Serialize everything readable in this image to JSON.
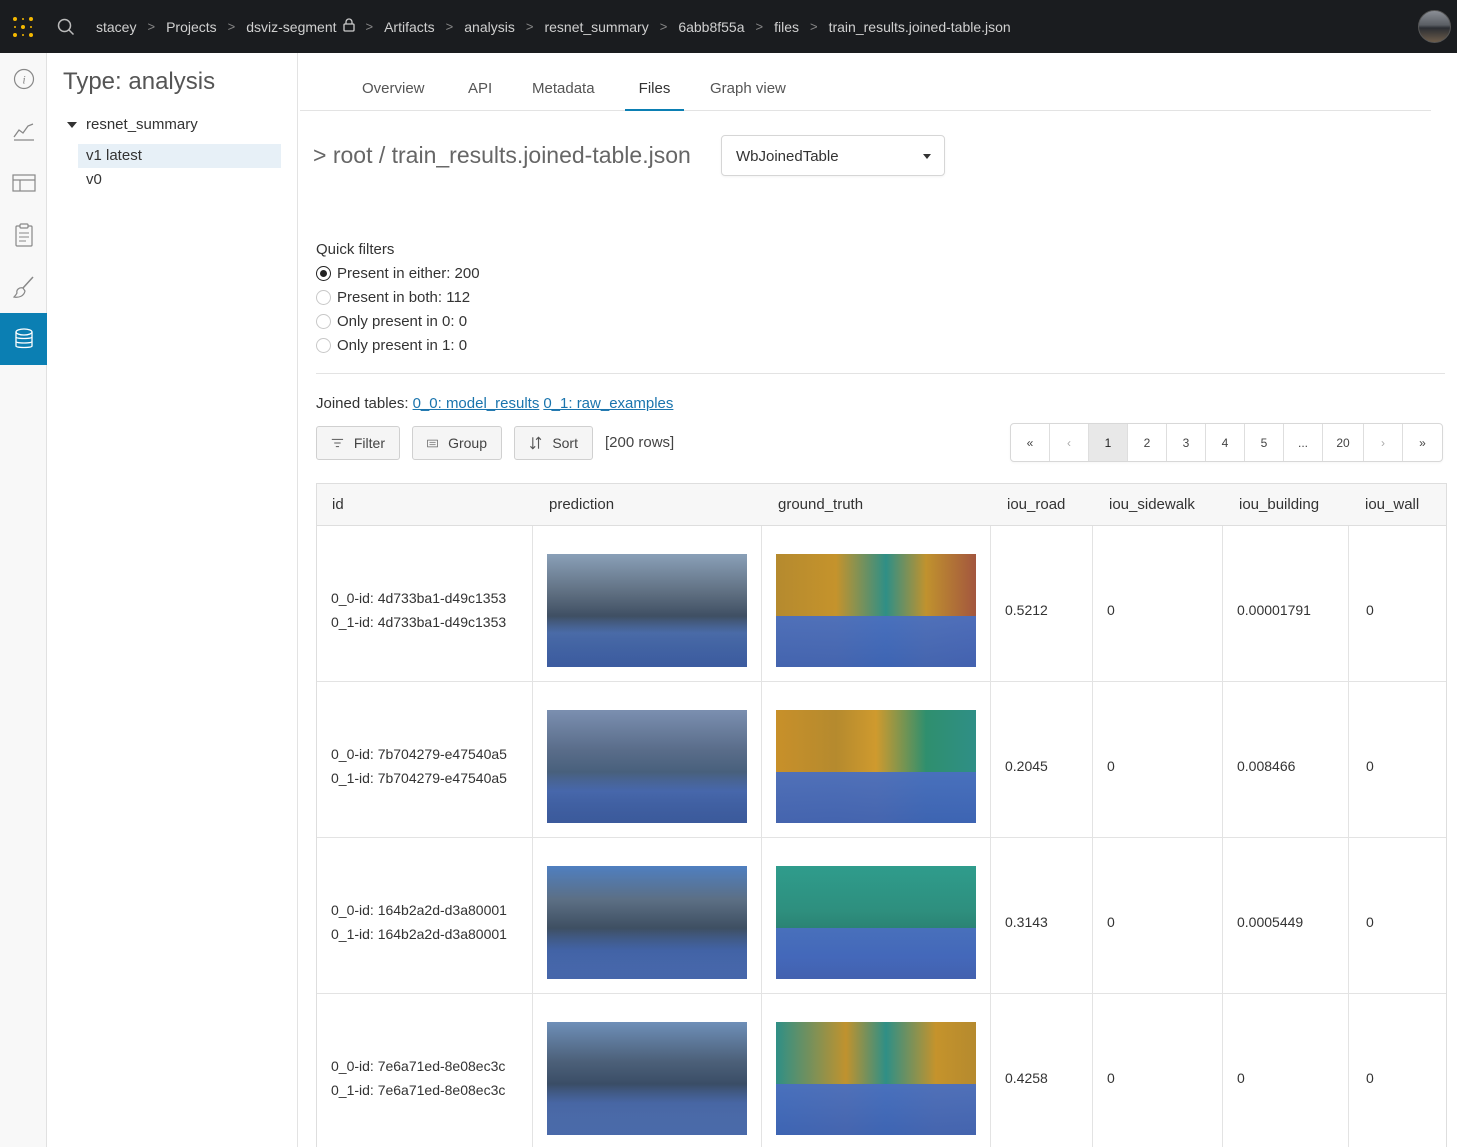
{
  "topbar": {
    "breadcrumbs": [
      "stacey",
      "Projects",
      "dsviz-segment",
      "Artifacts",
      "analysis",
      "resnet_summary",
      "6abb8f55a",
      "files",
      "train_results.joined-table.json"
    ]
  },
  "sidebar": {
    "title": "Type: analysis",
    "artifact": "resnet_summary",
    "versions": [
      "v1 latest",
      "v0"
    ]
  },
  "tabs": [
    "Overview",
    "API",
    "Metadata",
    "Files",
    "Graph view"
  ],
  "active_tab": "Files",
  "file_path": "> root / train_results.joined-table.json",
  "view_select": "WbJoinedTable",
  "quick_filters": {
    "label": "Quick filters",
    "options": [
      "Present in either: 200",
      "Present in both: 112",
      "Only present in 0: 0",
      "Only present in 1: 0"
    ],
    "selected": 0
  },
  "joined": {
    "label": "Joined tables:",
    "links": [
      "0_0: model_results",
      "0_1: raw_examples"
    ]
  },
  "toolbar": {
    "filter": "Filter",
    "group": "Group",
    "sort": "Sort",
    "rows": "[200 rows]"
  },
  "pager": [
    "«",
    "‹",
    "1",
    "2",
    "3",
    "4",
    "5",
    "...",
    "20",
    "›",
    "»"
  ],
  "pager_active": "1",
  "table": {
    "columns": [
      "id",
      "prediction",
      "ground_truth",
      "iou_road",
      "iou_sidewalk",
      "iou_building",
      "iou_wall"
    ],
    "rows": [
      {
        "id0": "0_0-id: 4d733ba1-d49c1353",
        "id1": "0_1-id: 4d733ba1-d49c1353",
        "iou_road": "0.5212",
        "iou_sidewalk": "0",
        "iou_building": "0.00001791",
        "iou_wall": "0"
      },
      {
        "id0": "0_0-id: 7b704279-e47540a5",
        "id1": "0_1-id: 7b704279-e47540a5",
        "iou_road": "0.2045",
        "iou_sidewalk": "0",
        "iou_building": "0.008466",
        "iou_wall": "0"
      },
      {
        "id0": "0_0-id: 164b2a2d-d3a80001",
        "id1": "0_1-id: 164b2a2d-d3a80001",
        "iou_road": "0.3143",
        "iou_sidewalk": "0",
        "iou_building": "0.0005449",
        "iou_wall": "0"
      },
      {
        "id0": "0_0-id: 7e6a71ed-8e08ec3c",
        "id1": "0_1-id: 7e6a71ed-8e08ec3c",
        "iou_road": "0.4258",
        "iou_sidewalk": "0",
        "iou_building": "0",
        "iou_wall": "0"
      }
    ]
  },
  "colors": {
    "accent": "#0b7fb3",
    "link": "#1a74ad",
    "topbar": "#1a1c1f",
    "logo": "#f5b800"
  }
}
